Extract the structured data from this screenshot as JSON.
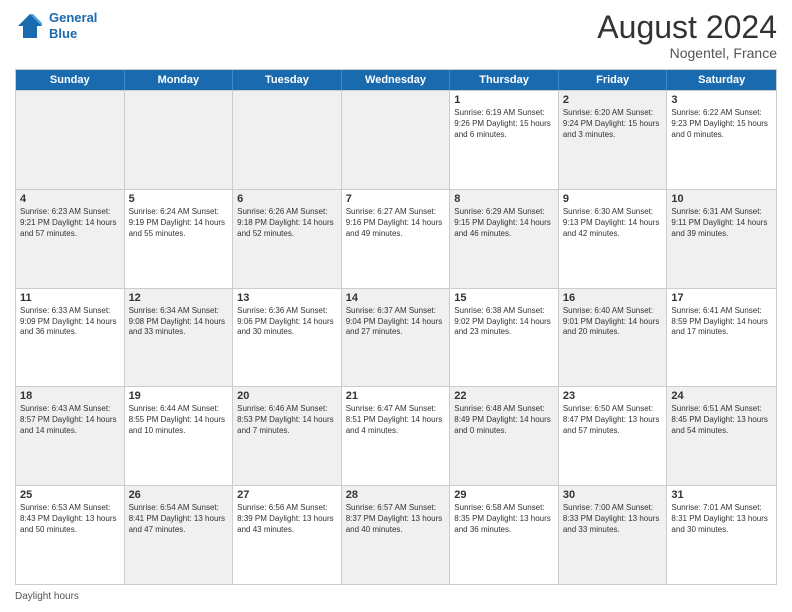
{
  "header": {
    "logo_line1": "General",
    "logo_line2": "Blue",
    "month_year": "August 2024",
    "location": "Nogentel, France"
  },
  "footer": {
    "label": "Daylight hours"
  },
  "days_of_week": [
    "Sunday",
    "Monday",
    "Tuesday",
    "Wednesday",
    "Thursday",
    "Friday",
    "Saturday"
  ],
  "weeks": [
    [
      {
        "day": "",
        "text": "",
        "shaded": true
      },
      {
        "day": "",
        "text": "",
        "shaded": true
      },
      {
        "day": "",
        "text": "",
        "shaded": true
      },
      {
        "day": "",
        "text": "",
        "shaded": true
      },
      {
        "day": "1",
        "text": "Sunrise: 6:19 AM\nSunset: 9:26 PM\nDaylight: 15 hours\nand 6 minutes."
      },
      {
        "day": "2",
        "text": "Sunrise: 6:20 AM\nSunset: 9:24 PM\nDaylight: 15 hours\nand 3 minutes.",
        "shaded": true
      },
      {
        "day": "3",
        "text": "Sunrise: 6:22 AM\nSunset: 9:23 PM\nDaylight: 15 hours\nand 0 minutes."
      }
    ],
    [
      {
        "day": "4",
        "text": "Sunrise: 6:23 AM\nSunset: 9:21 PM\nDaylight: 14 hours\nand 57 minutes.",
        "shaded": true
      },
      {
        "day": "5",
        "text": "Sunrise: 6:24 AM\nSunset: 9:19 PM\nDaylight: 14 hours\nand 55 minutes."
      },
      {
        "day": "6",
        "text": "Sunrise: 6:26 AM\nSunset: 9:18 PM\nDaylight: 14 hours\nand 52 minutes.",
        "shaded": true
      },
      {
        "day": "7",
        "text": "Sunrise: 6:27 AM\nSunset: 9:16 PM\nDaylight: 14 hours\nand 49 minutes."
      },
      {
        "day": "8",
        "text": "Sunrise: 6:29 AM\nSunset: 9:15 PM\nDaylight: 14 hours\nand 46 minutes.",
        "shaded": true
      },
      {
        "day": "9",
        "text": "Sunrise: 6:30 AM\nSunset: 9:13 PM\nDaylight: 14 hours\nand 42 minutes."
      },
      {
        "day": "10",
        "text": "Sunrise: 6:31 AM\nSunset: 9:11 PM\nDaylight: 14 hours\nand 39 minutes.",
        "shaded": true
      }
    ],
    [
      {
        "day": "11",
        "text": "Sunrise: 6:33 AM\nSunset: 9:09 PM\nDaylight: 14 hours\nand 36 minutes."
      },
      {
        "day": "12",
        "text": "Sunrise: 6:34 AM\nSunset: 9:08 PM\nDaylight: 14 hours\nand 33 minutes.",
        "shaded": true
      },
      {
        "day": "13",
        "text": "Sunrise: 6:36 AM\nSunset: 9:06 PM\nDaylight: 14 hours\nand 30 minutes."
      },
      {
        "day": "14",
        "text": "Sunrise: 6:37 AM\nSunset: 9:04 PM\nDaylight: 14 hours\nand 27 minutes.",
        "shaded": true
      },
      {
        "day": "15",
        "text": "Sunrise: 6:38 AM\nSunset: 9:02 PM\nDaylight: 14 hours\nand 23 minutes."
      },
      {
        "day": "16",
        "text": "Sunrise: 6:40 AM\nSunset: 9:01 PM\nDaylight: 14 hours\nand 20 minutes.",
        "shaded": true
      },
      {
        "day": "17",
        "text": "Sunrise: 6:41 AM\nSunset: 8:59 PM\nDaylight: 14 hours\nand 17 minutes."
      }
    ],
    [
      {
        "day": "18",
        "text": "Sunrise: 6:43 AM\nSunset: 8:57 PM\nDaylight: 14 hours\nand 14 minutes.",
        "shaded": true
      },
      {
        "day": "19",
        "text": "Sunrise: 6:44 AM\nSunset: 8:55 PM\nDaylight: 14 hours\nand 10 minutes."
      },
      {
        "day": "20",
        "text": "Sunrise: 6:46 AM\nSunset: 8:53 PM\nDaylight: 14 hours\nand 7 minutes.",
        "shaded": true
      },
      {
        "day": "21",
        "text": "Sunrise: 6:47 AM\nSunset: 8:51 PM\nDaylight: 14 hours\nand 4 minutes."
      },
      {
        "day": "22",
        "text": "Sunrise: 6:48 AM\nSunset: 8:49 PM\nDaylight: 14 hours\nand 0 minutes.",
        "shaded": true
      },
      {
        "day": "23",
        "text": "Sunrise: 6:50 AM\nSunset: 8:47 PM\nDaylight: 13 hours\nand 57 minutes."
      },
      {
        "day": "24",
        "text": "Sunrise: 6:51 AM\nSunset: 8:45 PM\nDaylight: 13 hours\nand 54 minutes.",
        "shaded": true
      }
    ],
    [
      {
        "day": "25",
        "text": "Sunrise: 6:53 AM\nSunset: 8:43 PM\nDaylight: 13 hours\nand 50 minutes."
      },
      {
        "day": "26",
        "text": "Sunrise: 6:54 AM\nSunset: 8:41 PM\nDaylight: 13 hours\nand 47 minutes.",
        "shaded": true
      },
      {
        "day": "27",
        "text": "Sunrise: 6:56 AM\nSunset: 8:39 PM\nDaylight: 13 hours\nand 43 minutes."
      },
      {
        "day": "28",
        "text": "Sunrise: 6:57 AM\nSunset: 8:37 PM\nDaylight: 13 hours\nand 40 minutes.",
        "shaded": true
      },
      {
        "day": "29",
        "text": "Sunrise: 6:58 AM\nSunset: 8:35 PM\nDaylight: 13 hours\nand 36 minutes."
      },
      {
        "day": "30",
        "text": "Sunrise: 7:00 AM\nSunset: 8:33 PM\nDaylight: 13 hours\nand 33 minutes.",
        "shaded": true
      },
      {
        "day": "31",
        "text": "Sunrise: 7:01 AM\nSunset: 8:31 PM\nDaylight: 13 hours\nand 30 minutes."
      }
    ]
  ]
}
